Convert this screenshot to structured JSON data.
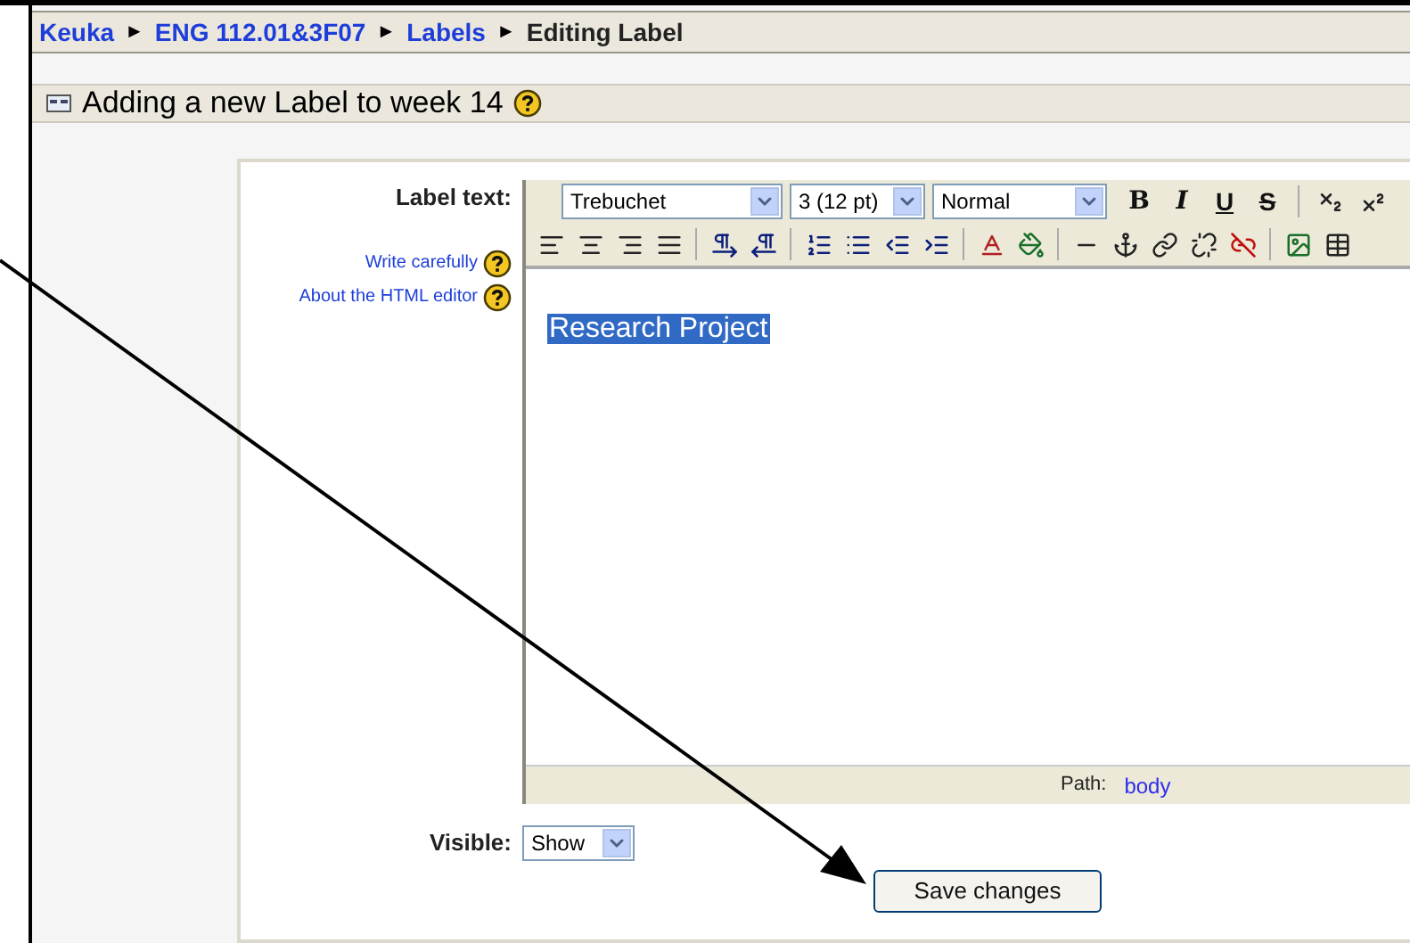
{
  "breadcrumb": [
    {
      "label": "Keuka",
      "kind": "link"
    },
    {
      "label": "ENG 112.01&3F07",
      "kind": "link"
    },
    {
      "label": "Labels",
      "kind": "link"
    },
    {
      "label": "Editing Label",
      "kind": "current"
    }
  ],
  "breadcrumb_separator": "►",
  "heading": "Adding a new Label to week 14",
  "form": {
    "label_text": "Label text:",
    "help_links": [
      "Write carefully",
      "About the HTML editor"
    ],
    "editor": {
      "font": "Trebuchet",
      "size": "3 (12 pt)",
      "format": "Normal",
      "format_buttons": [
        "B",
        "I",
        "U",
        "S"
      ],
      "content": "Research Project",
      "content_selected": true,
      "path_label": "Path:",
      "path_value": "body"
    },
    "visible_label": "Visible:",
    "visible_value": "Show",
    "save_button": "Save changes"
  }
}
